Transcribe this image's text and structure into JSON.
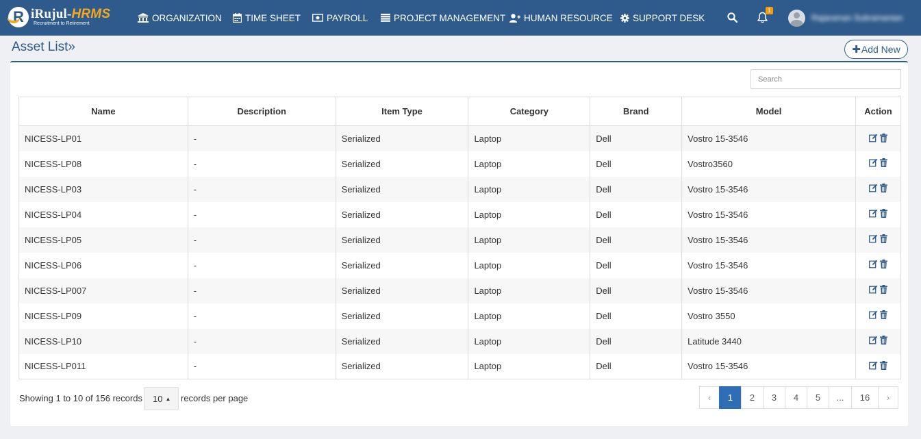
{
  "brand": {
    "name_prefix": "iRujul-",
    "name_suffix": "HRMS",
    "tagline": "Recruitment to Retirement"
  },
  "nav": [
    {
      "label": "ORGANIZATION",
      "icon": "bank-icon"
    },
    {
      "label": "TIME SHEET",
      "icon": "calendar-icon"
    },
    {
      "label": "PAYROLL",
      "icon": "money-icon"
    },
    {
      "label": "PROJECT MANAGEMENT",
      "icon": "list-icon"
    },
    {
      "label": "HUMAN RESOURCE",
      "icon": "user-plus-icon"
    },
    {
      "label": "SUPPORT DESK",
      "icon": "cog-icon"
    }
  ],
  "notifications": {
    "count": "1"
  },
  "user": {
    "name": "Rajaraman Subramanian"
  },
  "page": {
    "title": "Asset List",
    "title_suffix": "»",
    "add_label": "Add New"
  },
  "search": {
    "placeholder": "Search"
  },
  "table": {
    "headers": [
      "Name",
      "Description",
      "Item Type",
      "Category",
      "Brand",
      "Model",
      "Action"
    ],
    "rows": [
      [
        "NICESS-LP01",
        "-",
        "Serialized",
        "Laptop",
        "Dell",
        "Vostro 15-3546"
      ],
      [
        "NICESS-LP08",
        "-",
        "Serialized",
        "Laptop",
        "Dell",
        "Vostro3560"
      ],
      [
        "NICESS-LP03",
        "-",
        "Serialized",
        "Laptop",
        "Dell",
        "Vostro 15-3546"
      ],
      [
        "NICESS-LP04",
        "-",
        "Serialized",
        "Laptop",
        "Dell",
        "Vostro 15-3546"
      ],
      [
        "NICESS-LP05",
        "-",
        "Serialized",
        "Laptop",
        "Dell",
        "Vostro 15-3546"
      ],
      [
        "NICESS-LP06",
        "-",
        "Serialized",
        "Laptop",
        "Dell",
        "Vostro 15-3546"
      ],
      [
        "NICESS-LP007",
        "-",
        "Serialized",
        "Laptop",
        "Dell",
        "Vostro 15-3546"
      ],
      [
        "NICESS-LP09",
        "-",
        "Serialized",
        "Laptop",
        "Dell",
        "Vostro 3550"
      ],
      [
        "NICESS-LP10",
        "-",
        "Serialized",
        "Laptop",
        "Dell",
        "Latitude 3440"
      ],
      [
        "NICESS-LP011",
        "-",
        "Serialized",
        "Laptop",
        "Dell",
        "Vostro 15-3546"
      ]
    ]
  },
  "footer": {
    "info": "Showing 1 to 10 of 156 records",
    "per_page": "10",
    "per_page_label": "records per page"
  },
  "pagination": {
    "prev": "‹",
    "next": "›",
    "pages": [
      "1",
      "2",
      "3",
      "4",
      "5",
      "...",
      "16"
    ],
    "active": "1"
  },
  "colors": {
    "primary": "#2f5b8c",
    "accent": "#f3a81f",
    "active_page": "#2f6eb5"
  }
}
